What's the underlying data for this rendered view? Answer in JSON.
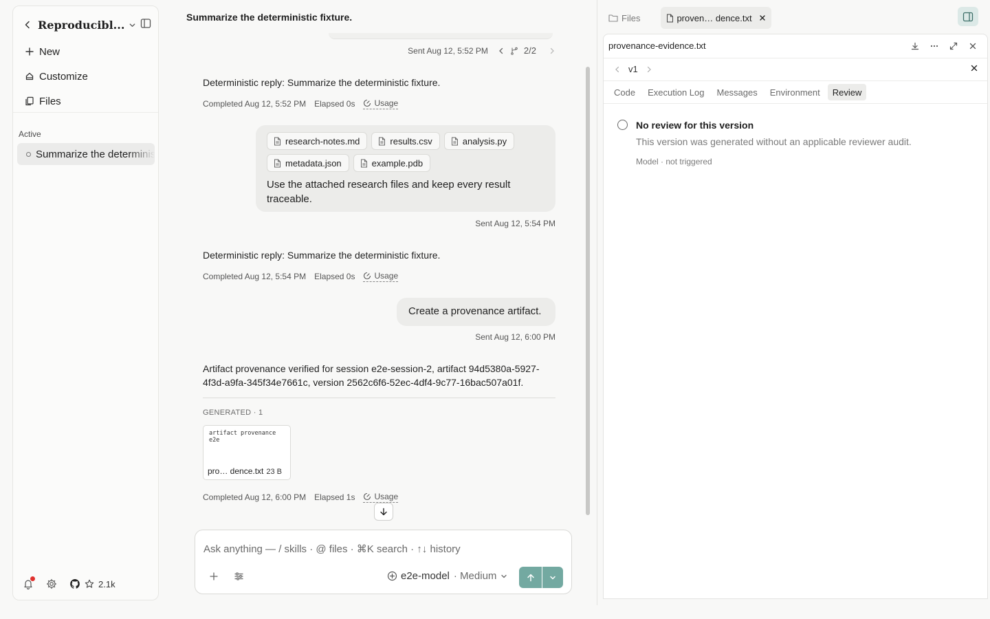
{
  "sidebar": {
    "project_title": "Reproducibl...",
    "nav": [
      {
        "label": "New",
        "icon": "plus-icon"
      },
      {
        "label": "Customize",
        "icon": "customize-icon"
      },
      {
        "label": "Files",
        "icon": "files-icon"
      }
    ],
    "section_label": "Active",
    "session_label": "Summarize the deterministic fixture.",
    "github_stars": "2.1k"
  },
  "chat": {
    "title": "Summarize the deterministic fixture.",
    "first_sent": "Sent Aug 12, 5:52 PM",
    "pager": "2/2",
    "messages": [
      {
        "reply": "Deterministic reply: Summarize the deterministic fixture.",
        "completed": "Completed Aug 12, 5:52 PM",
        "elapsed": "Elapsed 0s",
        "usage": "Usage"
      }
    ],
    "user2": {
      "attachments": [
        "research-notes.md",
        "results.csv",
        "analysis.py",
        "metadata.json",
        "example.pdb"
      ],
      "text": "Use the attached research files and keep every result traceable.",
      "sent": "Sent Aug 12, 5:54 PM"
    },
    "reply2": {
      "text": "Deterministic reply: Summarize the deterministic fixture.",
      "completed": "Completed Aug 12, 5:54 PM",
      "elapsed": "Elapsed 0s",
      "usage": "Usage"
    },
    "user3": {
      "text": "Create a provenance artifact.",
      "sent": "Sent Aug 12, 6:00 PM"
    },
    "reply3": {
      "text": "Artifact provenance verified for session e2e-session-2, artifact 94d5380a-5927-4f3d-a9fa-345f34e7661c, version 2562c6f6-52ec-4df4-9c77-16bac507a01f.",
      "generated_label": "GENERATED · 1",
      "artifact_preview": "artifact provenance e2e",
      "artifact_name": "pro… dence.txt",
      "artifact_size": "23 B",
      "completed": "Completed Aug 12, 6:00 PM",
      "elapsed": "Elapsed 1s",
      "usage": "Usage"
    }
  },
  "composer": {
    "placeholder": "Ask anything — / skills · @ files · ⌘K search · ↑↓ history",
    "model": "e2e-model",
    "effort": "· Medium"
  },
  "right_panel": {
    "files_tab": "Files",
    "file_tab": "proven… dence.txt",
    "filename": "provenance-evidence.txt",
    "version": "v1",
    "tabs": [
      "Code",
      "Execution Log",
      "Messages",
      "Environment",
      "Review"
    ],
    "active_tab": "Review",
    "review": {
      "title": "No review for this version",
      "description": "This version was generated without an applicable reviewer audit.",
      "meta": "Model · not triggered"
    }
  }
}
